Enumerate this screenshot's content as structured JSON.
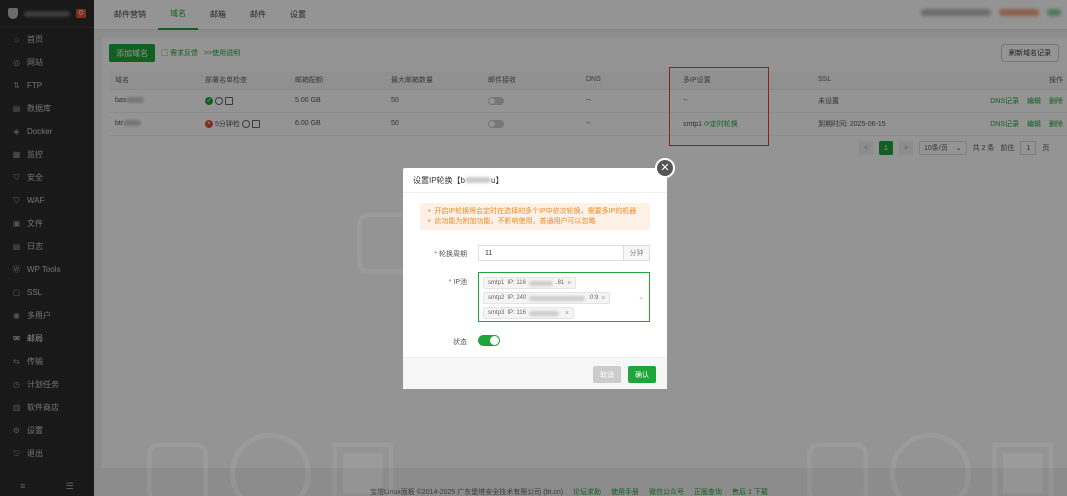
{
  "sidebar": {
    "badge": "0",
    "items": [
      {
        "label": "首页",
        "icon": "home-icon"
      },
      {
        "label": "网站",
        "icon": "globe-icon"
      },
      {
        "label": "FTP",
        "icon": "ftp-icon"
      },
      {
        "label": "数据库",
        "icon": "database-icon"
      },
      {
        "label": "Docker",
        "icon": "docker-icon"
      },
      {
        "label": "监控",
        "icon": "monitor-icon"
      },
      {
        "label": "安全",
        "icon": "shield-icon"
      },
      {
        "label": "WAF",
        "icon": "waf-icon"
      },
      {
        "label": "文件",
        "icon": "folder-icon"
      },
      {
        "label": "日志",
        "icon": "log-icon"
      },
      {
        "label": "WP Tools",
        "icon": "wordpress-icon"
      },
      {
        "label": "SSL",
        "icon": "ssl-icon"
      },
      {
        "label": "多用户",
        "icon": "users-icon"
      },
      {
        "label": "邮局",
        "icon": "mail-icon"
      },
      {
        "label": "传输",
        "icon": "transfer-icon"
      },
      {
        "label": "计划任务",
        "icon": "clock-icon"
      },
      {
        "label": "软件商店",
        "icon": "store-icon"
      },
      {
        "label": "设置",
        "icon": "gear-icon"
      },
      {
        "label": "退出",
        "icon": "logout-icon"
      }
    ],
    "active_index": 13
  },
  "topnav": {
    "tabs": [
      "邮件营销",
      "域名",
      "邮箱",
      "邮件",
      "设置"
    ],
    "active_index": 1
  },
  "toolbar": {
    "add_domain": "添加域名",
    "feedback": "需求反馈",
    "help": ">>使用说明",
    "refresh_records": "刷新域名记录"
  },
  "table": {
    "headers": [
      "域名",
      "部署名单检查",
      "邮箱配额",
      "最大邮箱数量",
      "邮件接收",
      "DNS",
      "多IP设置",
      "SSL",
      "操作"
    ],
    "rows": [
      {
        "domain_prefix": "bas",
        "quota": "5.00 GB",
        "max_mailbox": "50",
        "dns": "--",
        "multi_ip": "--",
        "ssl": "未设置",
        "ops": [
          "DNS记录",
          "编辑",
          "删除"
        ]
      },
      {
        "domain_prefix": "btr",
        "blacklist": "5分钟检",
        "quota": "6.00 GB",
        "max_mailbox": "50",
        "dns": "--",
        "multi_ip": "smtp1",
        "multi_ip_link": "定时轮换",
        "ssl": "到期时间: 2025-06-15",
        "ops": [
          "DNS记录",
          "编辑",
          "删除"
        ]
      }
    ]
  },
  "pager": {
    "prev": "<",
    "current": "1",
    "next": ">",
    "per_page": "10条/页",
    "total": "共 2 条",
    "goto": "前往",
    "page": "1",
    "page_unit": "页"
  },
  "footer": {
    "copyright": "宝塔Linux面板 ©2014-2025 广东堡塔安全技术有限公司 (bt.cn)",
    "links": [
      "论坛求助",
      "使用手册",
      "微信公众号",
      "正版查询",
      "售后 1 下载"
    ]
  },
  "modal": {
    "title_prefix": "设置IP轮换【b",
    "title_suffix": "u】",
    "alerts": [
      "开启IP轮换将会定时在选择的多个IP中依次轮换，需要多IP的机器",
      "此功能为附加功能，不影响使用，普通用户可以忽略"
    ],
    "period_label": "轮换周期",
    "period_value": "11",
    "period_unit": "分钟",
    "ip_label": "IP池",
    "ips": [
      {
        "name": "smtp1",
        "ip_prefix": "IP: 116",
        "ip_suffix": ".81"
      },
      {
        "name": "smtp2",
        "ip_prefix": "IP: 240",
        "ip_suffix": ":0:9"
      },
      {
        "name": "smtp3",
        "ip_prefix": "IP: 116",
        "ip_suffix": ""
      }
    ],
    "status_label": "状态",
    "status_on": true,
    "cancel": "取消",
    "confirm": "确认"
  },
  "colors": {
    "accent": "#20a53a",
    "sidebar_bg": "#2c2c2c",
    "highlight": "#e53935",
    "warning": "#f08a24"
  }
}
